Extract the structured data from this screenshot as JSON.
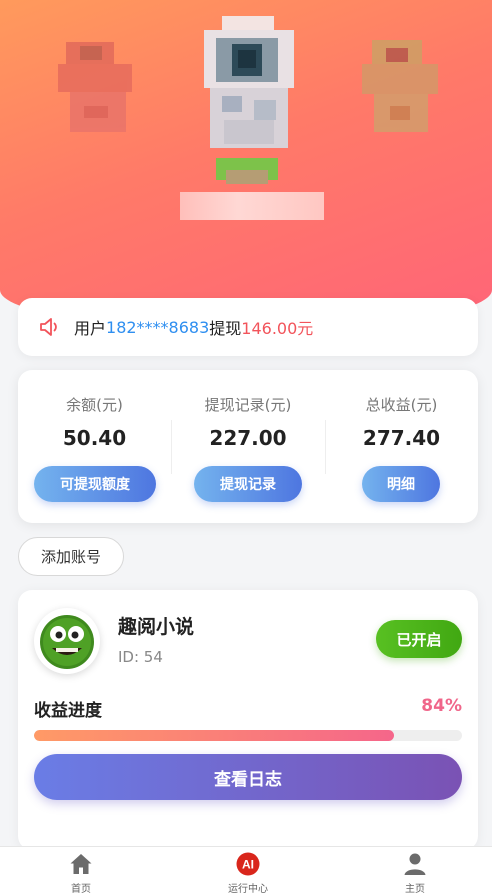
{
  "notice": {
    "icon": "speaker-icon",
    "prefix": "用户",
    "phone": "182****8683",
    "action": "提现",
    "amount": "146.00元"
  },
  "stats": [
    {
      "label": "余额(元)",
      "value": "50.40",
      "button": "可提现额度"
    },
    {
      "label": "提现记录(元)",
      "value": "227.00",
      "button": "提现记录"
    },
    {
      "label": "总收益(元)",
      "value": "277.40",
      "button": "明细"
    }
  ],
  "add_account": "添加账号",
  "app": {
    "name": "趣阅小说",
    "id": "ID: 54",
    "status": "已开启",
    "progress_label": "收益进度",
    "progress_value": 84,
    "progress_text": "84%",
    "log_button": "查看日志"
  },
  "tabs": [
    {
      "label": "首页",
      "icon": "home-icon"
    },
    {
      "label": "运行中心",
      "icon": "ai-icon",
      "icon_text": "AI"
    },
    {
      "label": "主页",
      "icon": "user-icon"
    }
  ],
  "colors": {
    "phone": "#2f8ff0",
    "amount": "#f2545b",
    "status_green": "#4bb31a",
    "progress_pct": "#f0668a"
  }
}
